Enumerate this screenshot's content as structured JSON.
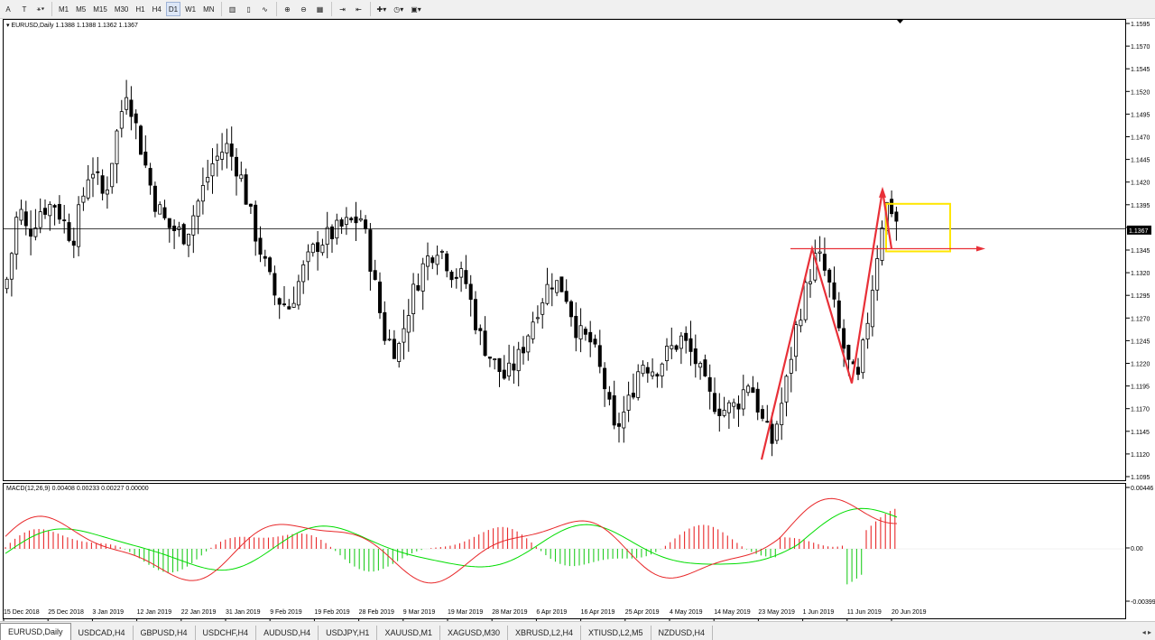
{
  "toolbar": {
    "items": [
      {
        "label": "A",
        "name": "text-tool-icon"
      },
      {
        "label": "T",
        "name": "text-label-tool-icon"
      },
      {
        "label": "⚹▾",
        "name": "shapes-dropdown-icon"
      },
      {
        "label": "M1",
        "name": "timeframe-m1-button"
      },
      {
        "label": "M5",
        "name": "timeframe-m5-button"
      },
      {
        "label": "M15",
        "name": "timeframe-m15-button"
      },
      {
        "label": "M30",
        "name": "timeframe-m30-button"
      },
      {
        "label": "H1",
        "name": "timeframe-h1-button"
      },
      {
        "label": "H4",
        "name": "timeframe-h4-button"
      },
      {
        "label": "D1",
        "name": "timeframe-d1-button",
        "active": true
      },
      {
        "label": "W1",
        "name": "timeframe-w1-button"
      },
      {
        "label": "MN",
        "name": "timeframe-mn-button"
      },
      {
        "label": "▥",
        "name": "bar-chart-icon"
      },
      {
        "label": "▯",
        "name": "candlestick-chart-icon"
      },
      {
        "label": "∿",
        "name": "line-chart-icon"
      },
      {
        "label": "⊕",
        "name": "zoom-in-icon"
      },
      {
        "label": "⊖",
        "name": "zoom-out-icon"
      },
      {
        "label": "▦",
        "name": "tile-windows-icon"
      },
      {
        "label": "⇥",
        "name": "autoscroll-icon"
      },
      {
        "label": "⇤",
        "name": "chart-shift-icon"
      },
      {
        "label": "✚▾",
        "name": "indicators-dropdown-icon"
      },
      {
        "label": "◷▾",
        "name": "periods-dropdown-icon"
      },
      {
        "label": "▣▾",
        "name": "templates-dropdown-icon"
      }
    ]
  },
  "chart": {
    "symbol_label": "▾  EURUSD,Daily  1.1388 1.1388 1.1362 1.1367",
    "current_price_label": "1.1367",
    "macd_label": "MACD(12,26,9) 0.00408 0.00233 0.00227 0.00000",
    "macd_scale": [
      "0.00446",
      "0.00",
      "-0.00399"
    ],
    "price_ticks": [
      "1.1595",
      "1.1570",
      "1.1545",
      "1.1520",
      "1.1495",
      "1.1470",
      "1.1445",
      "1.1420",
      "1.1395",
      "1.1370",
      "1.1345",
      "1.1320",
      "1.1295",
      "1.1270",
      "1.1245",
      "1.1220",
      "1.1195",
      "1.1170",
      "1.1145",
      "1.1120",
      "1.1095"
    ],
    "date_ticks": [
      "15 Dec 2018",
      "25 Dec 2018",
      "3 Jan 2019",
      "12 Jan 2019",
      "22 Jan 2019",
      "31 Jan 2019",
      "9 Feb 2019",
      "19 Feb 2019",
      "28 Feb 2019",
      "9 Mar 2019",
      "19 Mar 2019",
      "28 Mar 2019",
      "6 Apr 2019",
      "16 Apr 2019",
      "25 Apr 2019",
      "4 May 2019",
      "14 May 2019",
      "23 May 2019",
      "1 Jun 2019",
      "11 Jun 2019",
      "20 Jun 2019"
    ],
    "colors": {
      "up": "#ffffff",
      "down": "#000000",
      "macd_pos": "#e8282a",
      "macd_neg": "#22cc22",
      "signal": "#00dd00",
      "macd_line": "#e8282a",
      "box": "#ffe600",
      "arrows": "#e83038"
    }
  },
  "chart_data": {
    "type": "candlestick",
    "symbol": "EURUSD",
    "timeframe": "Daily",
    "ylim": [
      1.1095,
      1.1595
    ],
    "open_high_low_close_last": [
      1.1388,
      1.1388,
      1.1362,
      1.1367
    ]
  },
  "tabs": [
    {
      "label": "EURUSD,Daily",
      "active": true
    },
    {
      "label": "USDCAD,H4"
    },
    {
      "label": "GBPUSD,H4"
    },
    {
      "label": "USDCHF,H4"
    },
    {
      "label": "AUDUSD,H4"
    },
    {
      "label": "USDJPY,H1"
    },
    {
      "label": "XAUUSD,M1"
    },
    {
      "label": "XAGUSD,M30"
    },
    {
      "label": "XBRUSD,L2,H4"
    },
    {
      "label": "XTIUSD,L2,M5"
    },
    {
      "label": "NZDUSD,H4"
    }
  ],
  "tab_arrows": "◂ ▸"
}
